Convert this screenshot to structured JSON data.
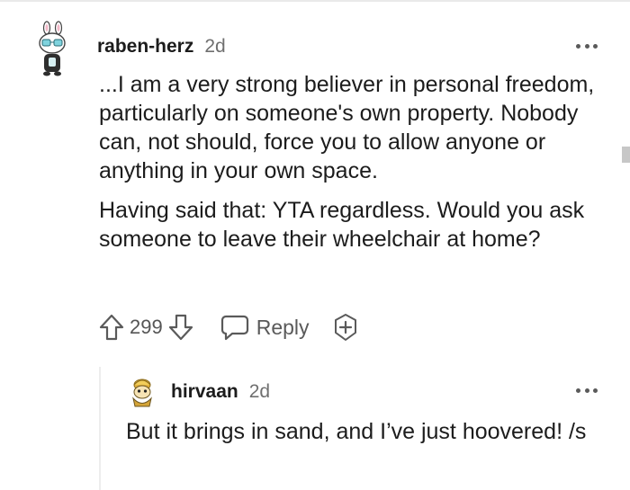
{
  "comment": {
    "username": "raben-herz",
    "timestamp": "2d",
    "avatar_icon": "bunny-snoo-avatar",
    "paragraphs": [
      "...I am a very strong believer in personal freedom, particularly on someone's own property. Nobody can, not should, force you to allow anyone or anything in your own space.",
      "Having said that: YTA regardless. Would you ask someone to leave their wheelchair at home?"
    ],
    "actions": {
      "score": "299",
      "reply_label": "Reply",
      "upvote_icon": "upvote-arrow-icon",
      "downvote_icon": "downvote-arrow-icon",
      "reply_icon": "speech-bubble-icon",
      "award_icon": "add-award-icon"
    },
    "more_icon": "more-options-icon"
  },
  "reply": {
    "username": "hirvaan",
    "timestamp": "2d",
    "avatar_icon": "gold-snoo-avatar",
    "text": "But it brings in sand, and I’ve just hoovered! /s",
    "more_icon": "more-options-icon"
  },
  "colors": {
    "text": "#1c1c1c",
    "muted": "#6f6f6f",
    "icon": "#5a5a5a",
    "thread_line": "#ededed"
  }
}
